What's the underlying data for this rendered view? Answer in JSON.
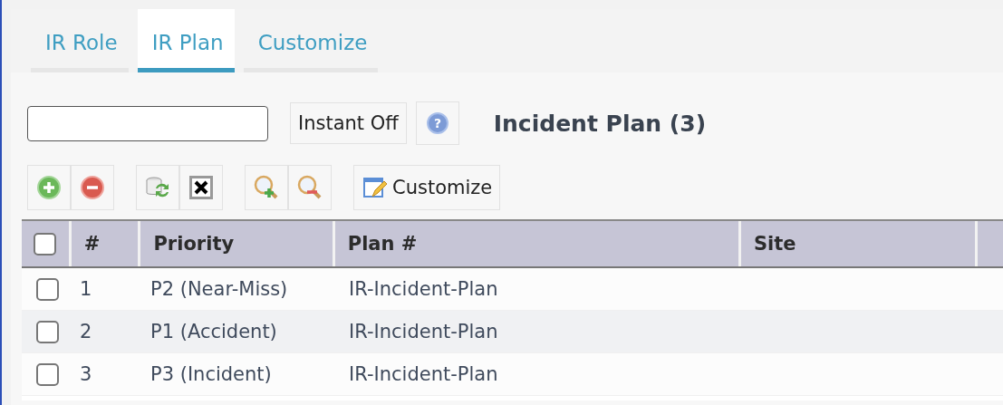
{
  "tabs": [
    {
      "label": "IR Role",
      "selected": false
    },
    {
      "label": "IR Plan",
      "selected": true
    },
    {
      "label": "Customize",
      "selected": false
    }
  ],
  "search": {
    "instant_button": "Instant Off",
    "help_icon": "?"
  },
  "title": "Incident Plan (3)",
  "toolbar": {
    "customize_label": "Customize"
  },
  "table": {
    "select_all_checked": false,
    "columns": [
      "#",
      "Priority",
      "Plan #",
      "Site"
    ],
    "rows": [
      {
        "checked": false,
        "cells": [
          "1",
          "P2 (Near-Miss)",
          "IR-Incident-Plan",
          ""
        ]
      },
      {
        "checked": false,
        "cells": [
          "2",
          "P1 (Accident)",
          "IR-Incident-Plan",
          ""
        ]
      },
      {
        "checked": false,
        "cells": [
          "3",
          "P3 (Incident)",
          "IR-Incident-Plan",
          ""
        ]
      }
    ]
  }
}
